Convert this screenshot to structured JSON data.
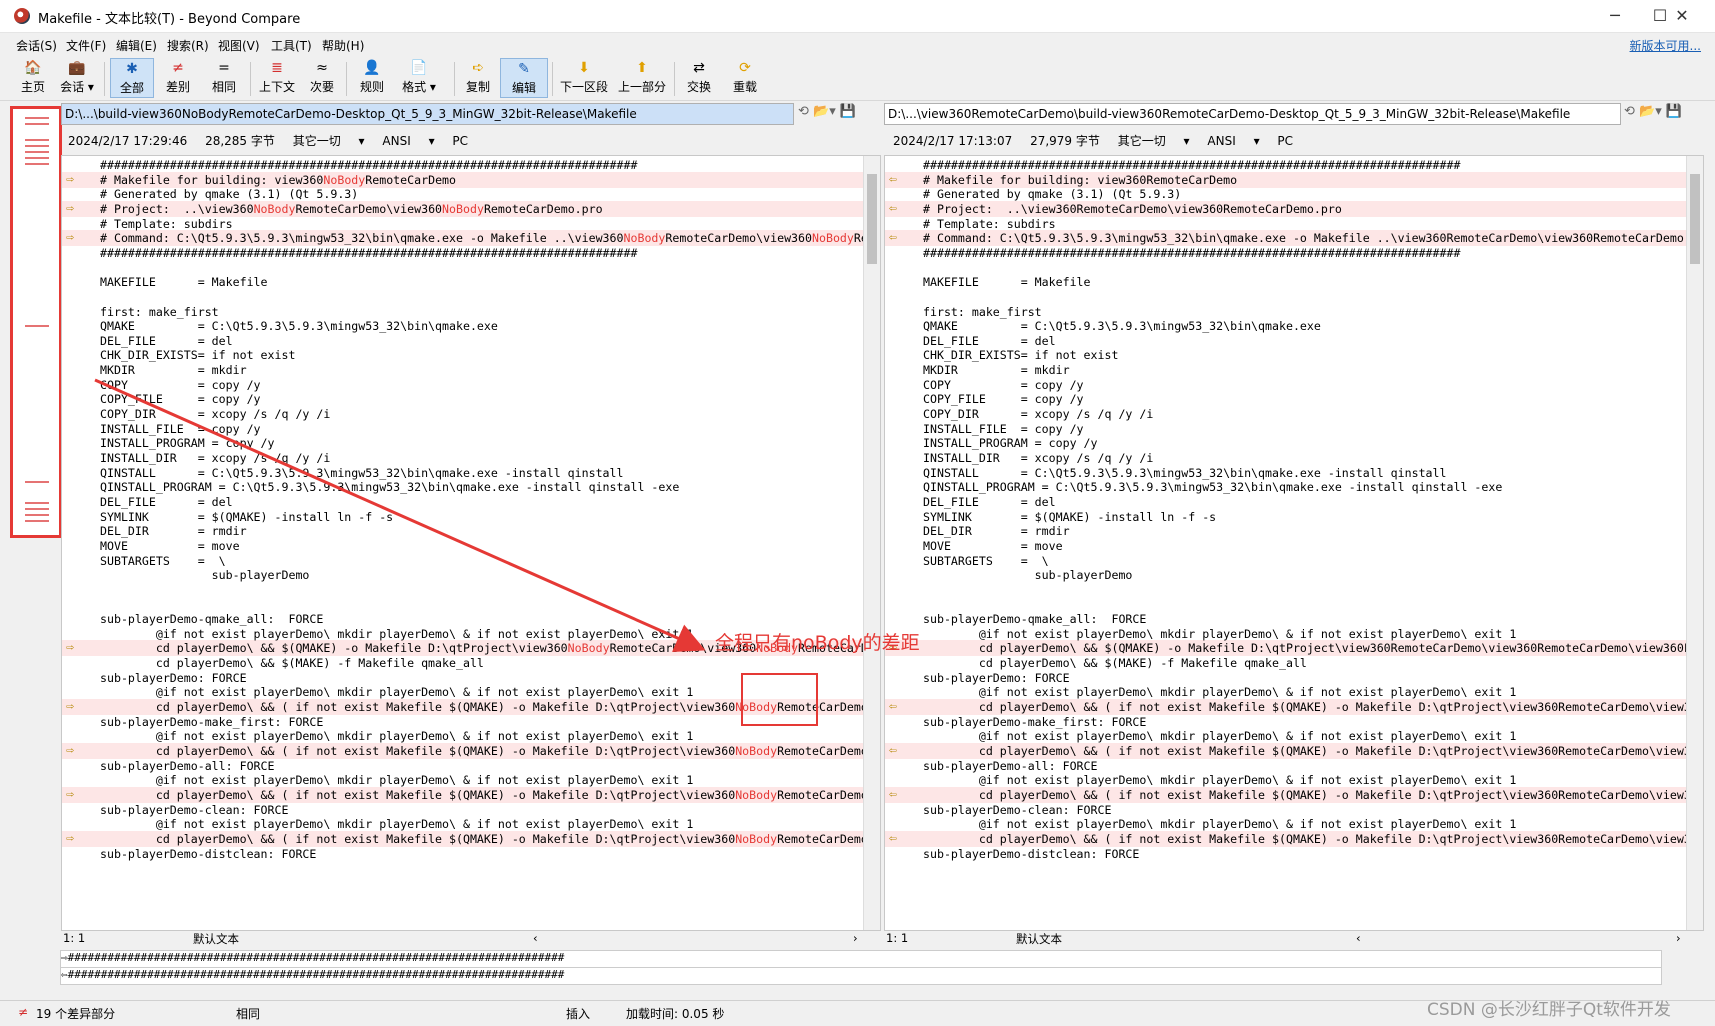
{
  "window": {
    "title": "Makefile - 文本比较(T) - Beyond Compare",
    "minimize": "─",
    "maximize": "☐",
    "close": "✕"
  },
  "menu": {
    "items": [
      "会话(S)",
      "文件(F)",
      "编辑(E)",
      "搜索(R)",
      "视图(V)",
      "工具(T)",
      "帮助(H)"
    ],
    "new_version": "新版本可用..."
  },
  "toolbar": {
    "home": "主页",
    "session": "会话",
    "all": "全部",
    "diffs": "差别",
    "same": "相同",
    "context": "上下文",
    "minor": "次要",
    "rules": "规则",
    "format": "格式",
    "copy": "复制",
    "edit": "编辑",
    "next_section": "下一区段",
    "prev_section": "上一部分",
    "swap": "交换",
    "reload": "重载"
  },
  "left": {
    "path": "D:\\...\\build-view360NoBodyRemoteCarDemo-Desktop_Qt_5_9_3_MinGW_32bit-Release\\Makefile",
    "date": "2024/2/17 17:29:46",
    "size": "28,285 字节",
    "other": "其它一切",
    "encoding": "ANSI",
    "lineend": "PC",
    "position": "1: 1",
    "default_text": "默认文本"
  },
  "right": {
    "path": "D:\\...\\view360RemoteCarDemo\\build-view360RemoteCarDemo-Desktop_Qt_5_9_3_MinGW_32bit-Release\\Makefile",
    "date": "2024/2/17 17:13:07",
    "size": "27,979 字节",
    "other": "其它一切",
    "encoding": "ANSI",
    "lineend": "PC",
    "position": "1: 1",
    "default_text": "默认文本"
  },
  "left_lines": [
    {
      "t": "#############################################################################",
      "d": false
    },
    {
      "t": "# Makefile for building: view360{NB}RemoteCarDemo",
      "d": true
    },
    {
      "t": "# Generated by qmake (3.1) (Qt 5.9.3)",
      "d": false
    },
    {
      "t": "# Project:  ..\\view360{NB}RemoteCarDemo\\view360{NB}RemoteCarDemo.pro",
      "d": true
    },
    {
      "t": "# Template: subdirs",
      "d": false
    },
    {
      "t": "# Command: C:\\Qt5.9.3\\5.9.3\\mingw53_32\\bin\\qmake.exe -o Makefile ..\\view360{NB}RemoteCarDemo\\view360{NB}Re",
      "d": true
    },
    {
      "t": "#############################################################################",
      "d": false
    },
    {
      "t": "",
      "d": false
    },
    {
      "t": "MAKEFILE      = Makefile",
      "d": false
    },
    {
      "t": "",
      "d": false
    },
    {
      "t": "first: make_first",
      "d": false
    },
    {
      "t": "QMAKE         = C:\\Qt5.9.3\\5.9.3\\mingw53_32\\bin\\qmake.exe",
      "d": false
    },
    {
      "t": "DEL_FILE      = del",
      "d": false
    },
    {
      "t": "CHK_DIR_EXISTS= if not exist",
      "d": false
    },
    {
      "t": "MKDIR         = mkdir",
      "d": false
    },
    {
      "t": "COPY          = copy /y",
      "d": false
    },
    {
      "t": "COPY_FILE     = copy /y",
      "d": false
    },
    {
      "t": "COPY_DIR      = xcopy /s /q /y /i",
      "d": false
    },
    {
      "t": "INSTALL_FILE  = copy /y",
      "d": false
    },
    {
      "t": "INSTALL_PROGRAM = copy /y",
      "d": false
    },
    {
      "t": "INSTALL_DIR   = xcopy /s /q /y /i",
      "d": false
    },
    {
      "t": "QINSTALL      = C:\\Qt5.9.3\\5.9.3\\mingw53_32\\bin\\qmake.exe -install qinstall",
      "d": false
    },
    {
      "t": "QINSTALL_PROGRAM = C:\\Qt5.9.3\\5.9.3\\mingw53_32\\bin\\qmake.exe -install qinstall -exe",
      "d": false
    },
    {
      "t": "DEL_FILE      = del",
      "d": false
    },
    {
      "t": "SYMLINK       = $(QMAKE) -install ln -f -s",
      "d": false
    },
    {
      "t": "DEL_DIR       = rmdir",
      "d": false
    },
    {
      "t": "MOVE          = move",
      "d": false
    },
    {
      "t": "SUBTARGETS    =  \\",
      "d": false
    },
    {
      "t": "                sub-playerDemo",
      "d": false
    },
    {
      "t": "",
      "d": false
    },
    {
      "t": "",
      "d": false
    },
    {
      "t": "sub-playerDemo-qmake_all:  FORCE",
      "d": false
    },
    {
      "t": "        @if not exist playerDemo\\ mkdir playerDemo\\ & if not exist playerDemo\\ exit 1",
      "d": false
    },
    {
      "t": "        cd playerDemo\\ && $(QMAKE) -o Makefile D:\\qtProject\\view360{NB}RemoteCarDemo\\view360{NB}RemoteCarD",
      "d": true
    },
    {
      "t": "        cd playerDemo\\ && $(MAKE) -f Makefile qmake_all",
      "d": false
    },
    {
      "t": "sub-playerDemo: FORCE",
      "d": false
    },
    {
      "t": "        @if not exist playerDemo\\ mkdir playerDemo\\ & if not exist playerDemo\\ exit 1",
      "d": false
    },
    {
      "t": "        cd playerDemo\\ && ( if not exist Makefile $(QMAKE) -o Makefile D:\\qtProject\\view360{NB}RemoteCarDemo",
      "d": true
    },
    {
      "t": "sub-playerDemo-make_first: FORCE",
      "d": false
    },
    {
      "t": "        @if not exist playerDemo\\ mkdir playerDemo\\ & if not exist playerDemo\\ exit 1",
      "d": false
    },
    {
      "t": "        cd playerDemo\\ && ( if not exist Makefile $(QMAKE) -o Makefile D:\\qtProject\\view360{NB}RemoteCarDemo",
      "d": true
    },
    {
      "t": "sub-playerDemo-all: FORCE",
      "d": false
    },
    {
      "t": "        @if not exist playerDemo\\ mkdir playerDemo\\ & if not exist playerDemo\\ exit 1",
      "d": false
    },
    {
      "t": "        cd playerDemo\\ && ( if not exist Makefile $(QMAKE) -o Makefile D:\\qtProject\\view360{NB}RemoteCarDemo",
      "d": true
    },
    {
      "t": "sub-playerDemo-clean: FORCE",
      "d": false
    },
    {
      "t": "        @if not exist playerDemo\\ mkdir playerDemo\\ & if not exist playerDemo\\ exit 1",
      "d": false
    },
    {
      "t": "        cd playerDemo\\ && ( if not exist Makefile $(QMAKE) -o Makefile D:\\qtProject\\view360{NB}RemoteCarDemo",
      "d": true
    },
    {
      "t": "sub-playerDemo-distclean: FORCE",
      "d": false
    }
  ],
  "right_lines": [
    {
      "t": "#############################################################################",
      "d": false
    },
    {
      "t": "# Makefile for building: view360RemoteCarDemo",
      "d": true
    },
    {
      "t": "# Generated by qmake (3.1) (Qt 5.9.3)",
      "d": false
    },
    {
      "t": "# Project:  ..\\view360RemoteCarDemo\\view360RemoteCarDemo.pro",
      "d": true
    },
    {
      "t": "# Template: subdirs",
      "d": false
    },
    {
      "t": "# Command: C:\\Qt5.9.3\\5.9.3\\mingw53_32\\bin\\qmake.exe -o Makefile ..\\view360RemoteCarDemo\\view360RemoteCarDemo.",
      "d": true
    },
    {
      "t": "#############################################################################",
      "d": false
    },
    {
      "t": "",
      "d": false
    },
    {
      "t": "MAKEFILE      = Makefile",
      "d": false
    },
    {
      "t": "",
      "d": false
    },
    {
      "t": "first: make_first",
      "d": false
    },
    {
      "t": "QMAKE         = C:\\Qt5.9.3\\5.9.3\\mingw53_32\\bin\\qmake.exe",
      "d": false
    },
    {
      "t": "DEL_FILE      = del",
      "d": false
    },
    {
      "t": "CHK_DIR_EXISTS= if not exist",
      "d": false
    },
    {
      "t": "MKDIR         = mkdir",
      "d": false
    },
    {
      "t": "COPY          = copy /y",
      "d": false
    },
    {
      "t": "COPY_FILE     = copy /y",
      "d": false
    },
    {
      "t": "COPY_DIR      = xcopy /s /q /y /i",
      "d": false
    },
    {
      "t": "INSTALL_FILE  = copy /y",
      "d": false
    },
    {
      "t": "INSTALL_PROGRAM = copy /y",
      "d": false
    },
    {
      "t": "INSTALL_DIR   = xcopy /s /q /y /i",
      "d": false
    },
    {
      "t": "QINSTALL      = C:\\Qt5.9.3\\5.9.3\\mingw53_32\\bin\\qmake.exe -install qinstall",
      "d": false
    },
    {
      "t": "QINSTALL_PROGRAM = C:\\Qt5.9.3\\5.9.3\\mingw53_32\\bin\\qmake.exe -install qinstall -exe",
      "d": false
    },
    {
      "t": "DEL_FILE      = del",
      "d": false
    },
    {
      "t": "SYMLINK       = $(QMAKE) -install ln -f -s",
      "d": false
    },
    {
      "t": "DEL_DIR       = rmdir",
      "d": false
    },
    {
      "t": "MOVE          = move",
      "d": false
    },
    {
      "t": "SUBTARGETS    =  \\",
      "d": false
    },
    {
      "t": "                sub-playerDemo",
      "d": false
    },
    {
      "t": "",
      "d": false
    },
    {
      "t": "",
      "d": false
    },
    {
      "t": "sub-playerDemo-qmake_all:  FORCE",
      "d": false
    },
    {
      "t": "        @if not exist playerDemo\\ mkdir playerDemo\\ & if not exist playerDemo\\ exit 1",
      "d": false
    },
    {
      "t": "        cd playerDemo\\ && $(QMAKE) -o Makefile D:\\qtProject\\view360RemoteCarDemo\\view360RemoteCarDemo\\view360F",
      "d": true
    },
    {
      "t": "        cd playerDemo\\ && $(MAKE) -f Makefile qmake_all",
      "d": false
    },
    {
      "t": "sub-playerDemo: FORCE",
      "d": false
    },
    {
      "t": "        @if not exist playerDemo\\ mkdir playerDemo\\ & if not exist playerDemo\\ exit 1",
      "d": false
    },
    {
      "t": "        cd playerDemo\\ && ( if not exist Makefile $(QMAKE) -o Makefile D:\\qtProject\\view360RemoteCarDemo\\view3",
      "d": true
    },
    {
      "t": "sub-playerDemo-make_first: FORCE",
      "d": false
    },
    {
      "t": "        @if not exist playerDemo\\ mkdir playerDemo\\ & if not exist playerDemo\\ exit 1",
      "d": false
    },
    {
      "t": "        cd playerDemo\\ && ( if not exist Makefile $(QMAKE) -o Makefile D:\\qtProject\\view360RemoteCarDemo\\view3",
      "d": true
    },
    {
      "t": "sub-playerDemo-all: FORCE",
      "d": false
    },
    {
      "t": "        @if not exist playerDemo\\ mkdir playerDemo\\ & if not exist playerDemo\\ exit 1",
      "d": false
    },
    {
      "t": "        cd playerDemo\\ && ( if not exist Makefile $(QMAKE) -o Makefile D:\\qtProject\\view360RemoteCarDemo\\view3",
      "d": true
    },
    {
      "t": "sub-playerDemo-clean: FORCE",
      "d": false
    },
    {
      "t": "        @if not exist playerDemo\\ mkdir playerDemo\\ & if not exist playerDemo\\ exit 1",
      "d": false
    },
    {
      "t": "        cd playerDemo\\ && ( if not exist Makefile $(QMAKE) -o Makefile D:\\qtProject\\view360RemoteCarDemo\\view3",
      "d": true
    },
    {
      "t": "sub-playerDemo-distclean: FORCE",
      "d": false
    }
  ],
  "bottom_lines": [
    "⇨###########################################################################",
    "⇦###########################################################################"
  ],
  "status": {
    "diff_count": "19 个差异部分",
    "same": "相同",
    "insert": "插入",
    "load_time": "加载时间: 0.05 秒"
  },
  "annotation": {
    "text": "全程只有noBody的差距"
  },
  "watermark": "CSDN @长沙红胖子Qt软件开发",
  "colors": {
    "diff_bg": "#fde6e6",
    "diff_text": "#e53935",
    "annotation": "#e53935"
  }
}
